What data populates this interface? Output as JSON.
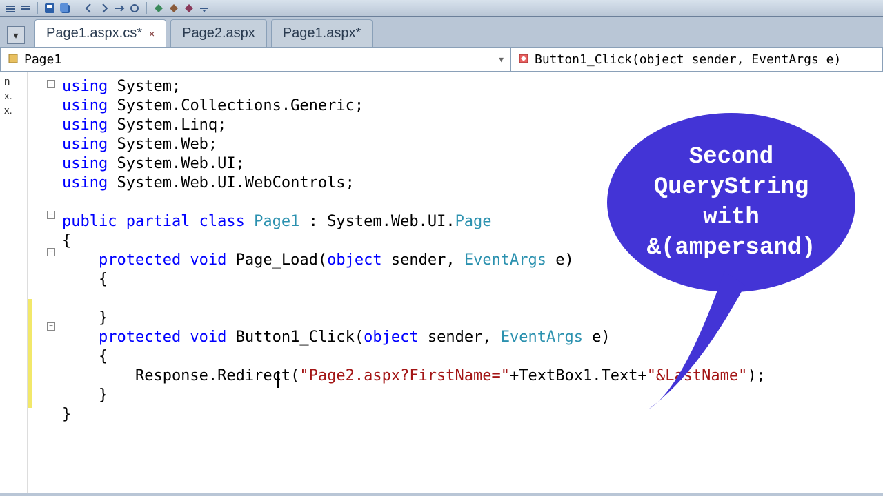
{
  "tabs": [
    {
      "label": "Page1.aspx.cs*",
      "active": true,
      "closable": true
    },
    {
      "label": "Page2.aspx",
      "active": false,
      "closable": false
    },
    {
      "label": "Page1.aspx*",
      "active": false,
      "closable": false
    }
  ],
  "dropdowns": {
    "class": "Page1",
    "method": "Button1_Click(object sender, EventArgs e)"
  },
  "usings": [
    "System",
    "System.Collections.Generic",
    "System.Linq",
    "System.Web",
    "System.Web.UI",
    "System.Web.UI.WebControls"
  ],
  "class_decl": {
    "modifiers": "public partial class",
    "name": "Page1",
    "base_prefix": "System.Web.UI.",
    "base": "Page"
  },
  "methods": [
    {
      "modifiers": "protected void",
      "name": "Page_Load",
      "params_kw": "object",
      "params_mid": " sender, ",
      "params_type": "EventArgs",
      "params_tail": " e",
      "body_lines": []
    },
    {
      "modifiers": "protected void",
      "name": "Button1_Click",
      "params_kw": "object",
      "params_mid": " sender, ",
      "params_type": "EventArgs",
      "params_tail": " e",
      "body_lines": [
        {
          "pre": "Response.Redirect(",
          "str1": "\"Page2.aspx?FirstName=\"",
          "mid": "+TextBox1.Text+",
          "str2": "\"&LastName\"",
          "post": ");"
        }
      ]
    }
  ],
  "callout": {
    "l1": "Second",
    "l2": "QueryString",
    "l3": "with",
    "l4": "&(ampersand)"
  },
  "sidepanel_fragments": [
    "n",
    "x.",
    "x."
  ],
  "close_glyph": "×"
}
